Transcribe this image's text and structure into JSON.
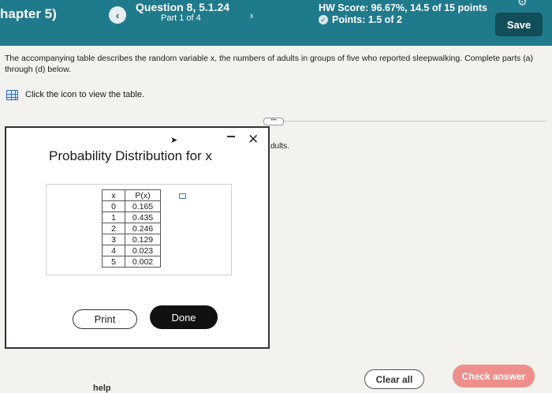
{
  "header": {
    "chapter": "hapter 5)",
    "prev_icon": "‹",
    "next_icon": "›",
    "question_title": "Question 8, 5.1.24",
    "part": "Part 1 of 4",
    "hw_score": "HW Score: 96.67%, 14.5 of 15 points",
    "points": "Points: 1.5 of 2",
    "save_label": "Save",
    "accent_color": "#1f7a8c"
  },
  "main": {
    "instructions": "The accompanying table describes the random variable x, the numbers of adults in groups of five who reported sleepwalking. Complete parts (a) through (d) below.",
    "icon_link": "Click the icon to view the table.",
    "behind_text": "dults.",
    "help_text": "help",
    "clear_all_label": "Clear all",
    "check_answer_label": "Check answer"
  },
  "modal": {
    "title": "Probability Distribution for x",
    "table": {
      "headers": [
        "x",
        "P(x)"
      ],
      "rows": [
        [
          "0",
          "0.165"
        ],
        [
          "1",
          "0.435"
        ],
        [
          "2",
          "0.246"
        ],
        [
          "3",
          "0.129"
        ],
        [
          "4",
          "0.023"
        ],
        [
          "5",
          "0.002"
        ]
      ]
    },
    "print_label": "Print",
    "done_label": "Done"
  }
}
